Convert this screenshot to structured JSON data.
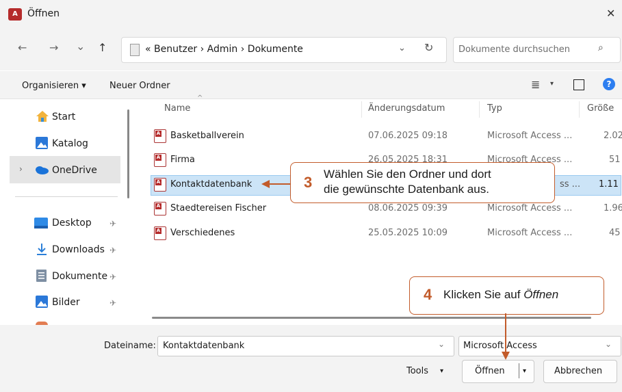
{
  "window": {
    "title": "Öffnen",
    "close_glyph": "✕",
    "app_icon": "access-icon",
    "app_icon_glyph": "A"
  },
  "nav": {
    "back_glyph": "←",
    "forward_glyph": "→",
    "recent_glyph": "⌄",
    "up_glyph": "↑",
    "breadcrumb": "«  Benutzer  ›  Admin  ›  Dokumente",
    "address_chevron": "⌄",
    "refresh_glyph": "↻",
    "search_placeholder": "Dokumente durchsuchen",
    "search_glyph": "⌕"
  },
  "toolbar": {
    "organize_label": "Organisieren ▾",
    "new_folder_label": "Neuer Ordner",
    "view_glyph": "≣",
    "view_drop": "▾",
    "help_glyph": "?"
  },
  "sidebar": {
    "items": [
      {
        "label": "Start",
        "icon": "home-icon"
      },
      {
        "label": "Katalog",
        "icon": "gallery-icon"
      },
      {
        "label": "OneDrive",
        "icon": "cloud-icon",
        "chevron": "›"
      },
      {
        "label": "Desktop",
        "icon": "desktop-icon",
        "pin": "📌"
      },
      {
        "label": "Downloads",
        "icon": "download-icon",
        "pin": "📌"
      },
      {
        "label": "Dokumente",
        "icon": "document-icon",
        "pin": "📌"
      },
      {
        "label": "Bilder",
        "icon": "pictures-icon",
        "pin": "📌"
      }
    ]
  },
  "columns": {
    "name": "Name",
    "date": "Änderungsdatum",
    "type": "Typ",
    "size": "Größe",
    "sort_glyph": "^"
  },
  "files": [
    {
      "name": "Basketballverein",
      "date": "07.06.2025 09:18",
      "type": "Microsoft Access ...",
      "size": "2.02"
    },
    {
      "name": "Firma",
      "date": "26.05.2025 18:31",
      "type": "Microsoft Access ...",
      "size": "51"
    },
    {
      "name": "Kontaktdatenbank",
      "date": "",
      "type": "ss ...",
      "size": "1.11"
    },
    {
      "name": "Staedtereisen Fischer",
      "date": "08.06.2025 09:39",
      "type": "Microsoft Access ...",
      "size": "1.96"
    },
    {
      "name": "Verschiedenes",
      "date": "25.05.2025 10:09",
      "type": "Microsoft Access ...",
      "size": "45"
    }
  ],
  "footer": {
    "filename_label": "Dateiname:",
    "filename_value": "Kontaktdatenbank",
    "filetype_value": "Microsoft Access",
    "dropdown_glyph": "⌄",
    "tools_label": "Tools",
    "tools_drop": "▾",
    "open_label": "Öffnen",
    "open_drop": "▾",
    "cancel_label": "Abbrechen"
  },
  "callouts": {
    "step3": {
      "number": "3",
      "line1": "Wählen Sie den Ordner und dort",
      "line2": "die gewünschte Datenbank aus."
    },
    "step4": {
      "number": "4",
      "text": "Klicken Sie auf ",
      "emphasis": "Öffnen"
    }
  },
  "colors": {
    "accent": "#c25b2a",
    "selection": "#cce4f7",
    "access_red": "#b52b2b"
  }
}
